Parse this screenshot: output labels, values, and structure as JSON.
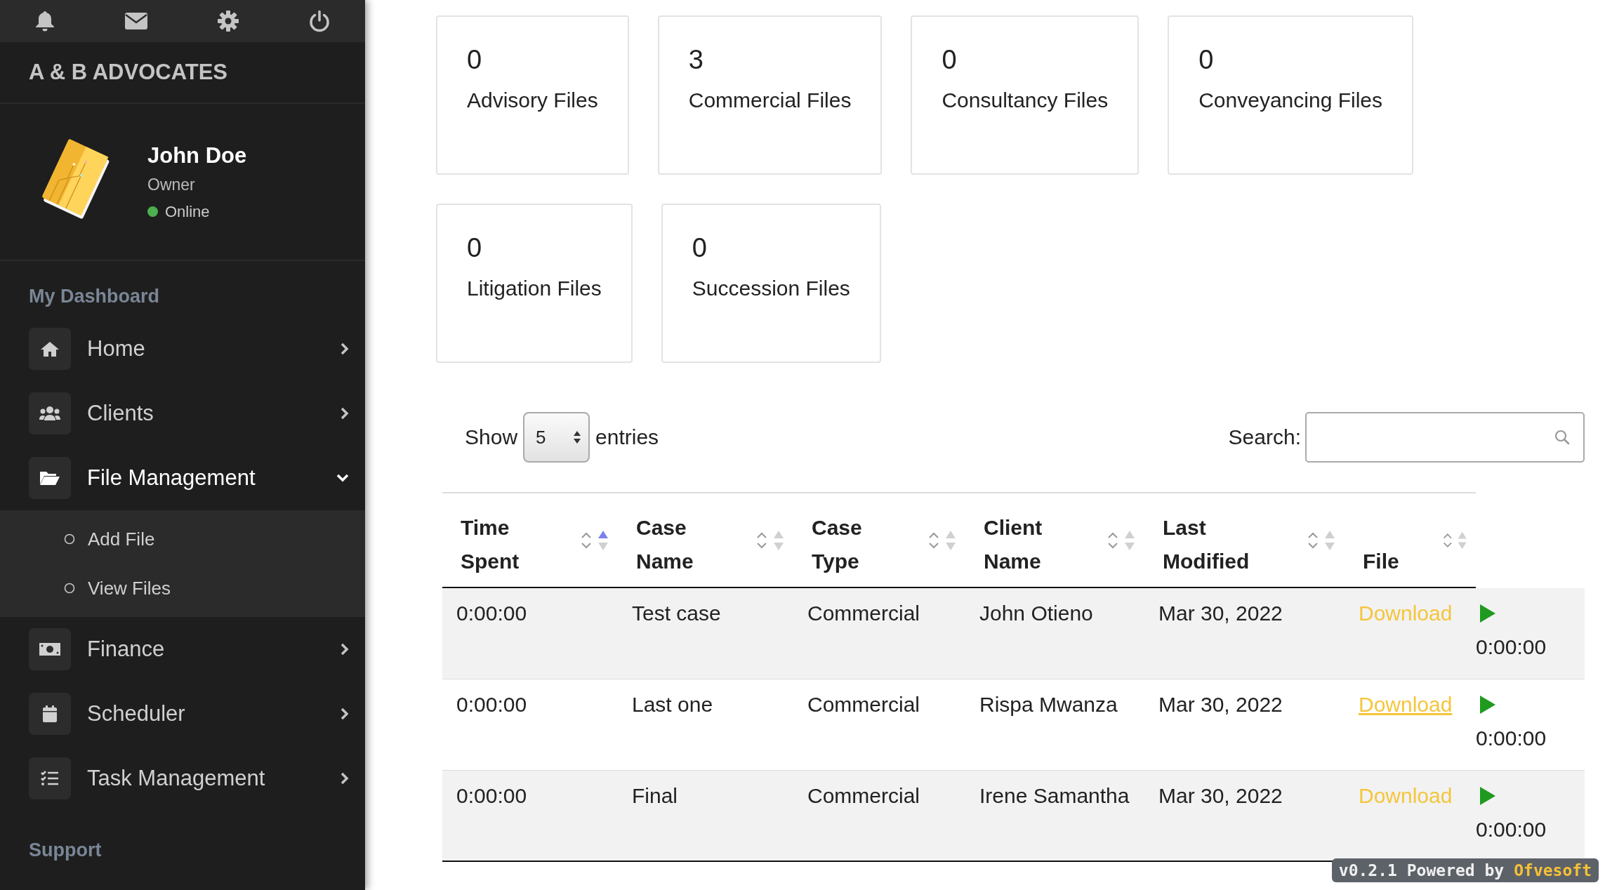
{
  "brand": "A & B ADVOCATES",
  "profile": {
    "name": "John Doe",
    "role": "Owner",
    "status": "Online",
    "online": true
  },
  "sidebar": {
    "sections": [
      {
        "heading": "My Dashboard",
        "items": [
          {
            "label": "Home",
            "expanded": false
          },
          {
            "label": "Clients",
            "expanded": false
          },
          {
            "label": "File Management",
            "expanded": true,
            "children": [
              {
                "label": "Add File"
              },
              {
                "label": "View Files"
              }
            ]
          },
          {
            "label": "Finance",
            "expanded": false
          },
          {
            "label": "Scheduler",
            "expanded": false
          },
          {
            "label": "Task Management",
            "expanded": false
          }
        ]
      },
      {
        "heading": "Support"
      }
    ]
  },
  "stats": [
    {
      "count": "0",
      "label": "Advisory Files"
    },
    {
      "count": "3",
      "label": "Commercial Files"
    },
    {
      "count": "0",
      "label": "Consultancy Files"
    },
    {
      "count": "0",
      "label": "Conveyancing Files"
    },
    {
      "count": "0",
      "label": "Litigation Files"
    },
    {
      "count": "0",
      "label": "Succession Files"
    }
  ],
  "table_controls": {
    "show_label": "Show",
    "page_size": "5",
    "entries_label": "entries",
    "search_label": "Search:"
  },
  "table": {
    "columns": [
      {
        "label": "Time Spent",
        "sorted_ascending": true
      },
      {
        "label": "Case Name",
        "sorted_ascending": false
      },
      {
        "label": "Case Type",
        "sorted_ascending": false
      },
      {
        "label": "Client Name",
        "sorted_ascending": false
      },
      {
        "label": "Last Modified",
        "sorted_ascending": false
      },
      {
        "label": "File",
        "sorted_ascending": false
      }
    ],
    "rows": [
      {
        "time_spent": "0:00:00",
        "case_name": "Test case",
        "case_type": "Commercial",
        "client_name": "John Otieno",
        "last_modified": "Mar 30, 2022",
        "file": "Download",
        "hovered": false,
        "timer": "0:00:00"
      },
      {
        "time_spent": "0:00:00",
        "case_name": "Last one",
        "case_type": "Commercial",
        "client_name": "Rispa Mwanza",
        "last_modified": "Mar 30, 2022",
        "file": "Download",
        "hovered": true,
        "timer": "0:00:00"
      },
      {
        "time_spent": "0:00:00",
        "case_name": "Final",
        "case_type": "Commercial",
        "client_name": "Irene Samantha",
        "last_modified": "Mar 30, 2022",
        "file": "Download",
        "hovered": false,
        "timer": "0:00:00"
      }
    ]
  },
  "badge": {
    "text": "v0.2.1 Powered by",
    "brand": "Ofvesoft"
  }
}
